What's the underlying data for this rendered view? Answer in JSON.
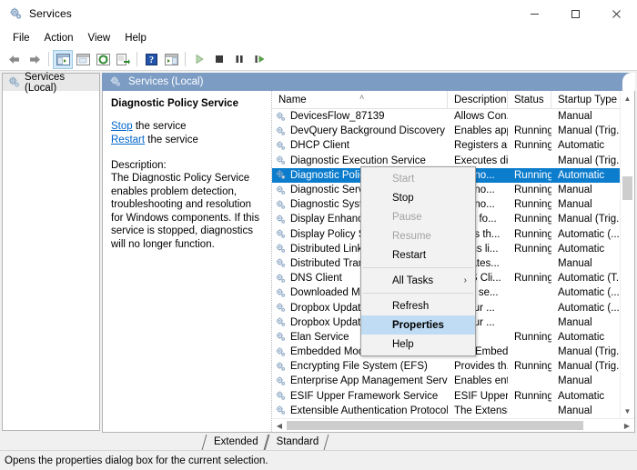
{
  "window": {
    "title": "Services",
    "icon": "services-gear-icon",
    "controls": {
      "minimize": "—",
      "maximize": "□",
      "close": "✕"
    }
  },
  "menubar": {
    "items": [
      "File",
      "Action",
      "View",
      "Help"
    ]
  },
  "toolbar": {
    "buttons": [
      {
        "name": "back-arrow-icon",
        "label": "Back"
      },
      {
        "name": "forward-arrow-icon",
        "label": "Forward"
      },
      {
        "name": "show-hide-console-tree-icon",
        "label": "Show/Hide Console Tree"
      },
      {
        "name": "properties-window-icon",
        "label": "Properties"
      },
      {
        "name": "refresh-icon",
        "label": "Refresh"
      },
      {
        "name": "export-list-icon",
        "label": "Export List"
      },
      {
        "name": "help-icon",
        "label": "Help"
      },
      {
        "name": "show-hide-action-pane-icon",
        "label": "Show/Hide Action Pane"
      },
      {
        "name": "start-service-icon",
        "label": "Start Service"
      },
      {
        "name": "stop-service-icon",
        "label": "Stop Service"
      },
      {
        "name": "pause-service-icon",
        "label": "Pause Service"
      },
      {
        "name": "restart-service-icon",
        "label": "Restart Service"
      }
    ]
  },
  "tree": {
    "root_label": "Services (Local)"
  },
  "pane_header": {
    "label": "Services (Local)",
    "icon": "services-gear-icon",
    "bg_color": "#7c9cc4"
  },
  "details": {
    "service_name": "Diagnostic Policy Service",
    "links": [
      {
        "action": "Stop",
        "suffix": " the service"
      },
      {
        "action": "Restart",
        "suffix": " the service"
      }
    ],
    "description_label": "Description:",
    "description_text": "The Diagnostic Policy Service enables problem detection, troubleshooting and resolution for Windows components.  If this service is stopped, diagnostics will no longer function."
  },
  "list": {
    "columns": [
      {
        "key": "name",
        "label": "Name",
        "sorted": "ascending",
        "sort_glyph": "˄"
      },
      {
        "key": "description",
        "label": "Description"
      },
      {
        "key": "status",
        "label": "Status"
      },
      {
        "key": "startup",
        "label": "Startup Type"
      }
    ],
    "selected_index": 4,
    "rows": [
      {
        "name": "DevicesFlow_87139",
        "description": "Allows Con...",
        "status": "",
        "startup": "Manual"
      },
      {
        "name": "DevQuery Background Discovery B...",
        "description": "Enables app...",
        "status": "Running",
        "startup": "Manual (Trig..."
      },
      {
        "name": "DHCP Client",
        "description": "Registers an...",
        "status": "Running",
        "startup": "Automatic"
      },
      {
        "name": "Diagnostic Execution Service",
        "description": "Executes di...",
        "status": "",
        "startup": "Manual (Trig..."
      },
      {
        "name": "Diagnostic Policy Service",
        "description": "...agno...",
        "status": "Running",
        "startup": "Automatic"
      },
      {
        "name": "Diagnostic Service Host",
        "description": "...agno...",
        "status": "Running",
        "startup": "Manual"
      },
      {
        "name": "Diagnostic System Host",
        "description": "...agno...",
        "status": "Running",
        "startup": "Manual"
      },
      {
        "name": "Display Enhancement Service",
        "description": "...ice fo...",
        "status": "Running",
        "startup": "Manual (Trig..."
      },
      {
        "name": "Display Policy Service",
        "description": "...ges th...",
        "status": "Running",
        "startup": "Automatic (..."
      },
      {
        "name": "Distributed Link Tracking Client",
        "description": "...ains li...",
        "status": "Running",
        "startup": "Automatic"
      },
      {
        "name": "Distributed Transaction Coordinator",
        "description": "...inates...",
        "status": "",
        "startup": "Manual"
      },
      {
        "name": "DNS Client",
        "description": "...NS Cli...",
        "status": "Running",
        "startup": "Automatic (T..."
      },
      {
        "name": "Downloaded Maps Manager",
        "description": "...ws se...",
        "status": "",
        "startup": "Automatic (..."
      },
      {
        "name": "Dropbox Update Service (dbupdate)",
        "description": "...your ...",
        "status": "",
        "startup": "Automatic (..."
      },
      {
        "name": "Dropbox Update Service (dbupdatem)",
        "description": "...your ...",
        "status": "",
        "startup": "Manual"
      },
      {
        "name": "Elan Service",
        "description": "",
        "status": "Running",
        "startup": "Automatic"
      },
      {
        "name": "Embedded Mode",
        "description": "The Embed...",
        "status": "",
        "startup": "Manual (Trig..."
      },
      {
        "name": "Encrypting File System (EFS)",
        "description": "Provides th...",
        "status": "Running",
        "startup": "Manual (Trig..."
      },
      {
        "name": "Enterprise App Management Service",
        "description": "Enables ent...",
        "status": "",
        "startup": "Manual"
      },
      {
        "name": "ESIF Upper Framework Service",
        "description": "ESIF Upper ...",
        "status": "Running",
        "startup": "Automatic"
      },
      {
        "name": "Extensible Authentication Protocol",
        "description": "The Extensi...",
        "status": "",
        "startup": "Manual"
      }
    ]
  },
  "context_menu": {
    "items": [
      {
        "label": "Start",
        "state": "disabled"
      },
      {
        "label": "Stop",
        "state": "enabled"
      },
      {
        "label": "Pause",
        "state": "disabled"
      },
      {
        "label": "Resume",
        "state": "disabled"
      },
      {
        "label": "Restart",
        "state": "enabled"
      },
      {
        "separator_after": true,
        "label": "All Tasks",
        "state": "enabled",
        "submenu": true,
        "submenu_glyph": "›"
      },
      {
        "label": "Refresh",
        "state": "enabled"
      },
      {
        "label": "Properties",
        "state": "highlighted"
      },
      {
        "label": "Help",
        "state": "enabled"
      }
    ],
    "highlight_color": "#bfdcf4"
  },
  "tabs": {
    "items": [
      "Extended",
      "Standard"
    ],
    "active": "Extended"
  },
  "statusbar": {
    "text": "Opens the properties dialog box for the current selection."
  }
}
